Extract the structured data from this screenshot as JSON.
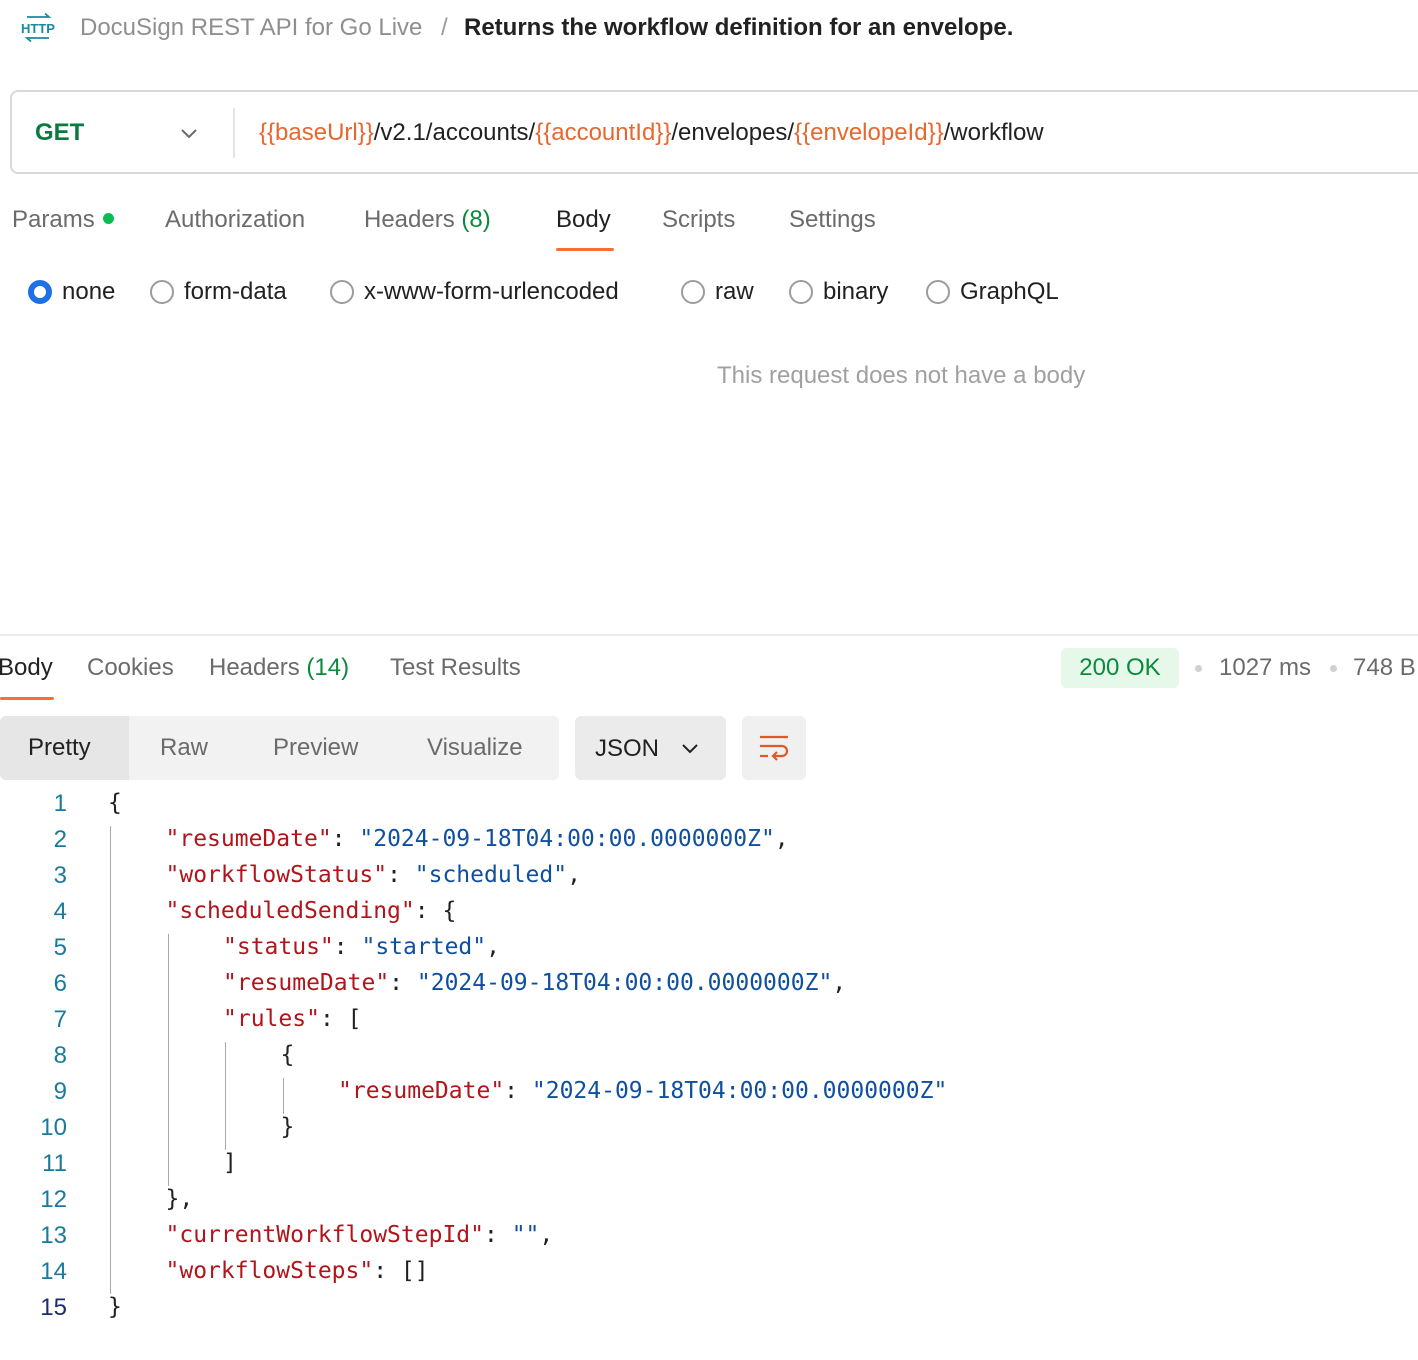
{
  "breadcrumb": {
    "icon": "http-request-icon",
    "collection": "DocuSign REST API for Go Live",
    "separator": "/",
    "title": "Returns the workflow definition for an envelope."
  },
  "request": {
    "method": "GET",
    "url_parts": [
      {
        "text": "{{baseUrl}}",
        "var": true
      },
      {
        "text": "/v2.1/accounts/",
        "var": false
      },
      {
        "text": "{{accountId}}",
        "var": true
      },
      {
        "text": "/envelopes/",
        "var": false
      },
      {
        "text": "{{envelopeId}}",
        "var": true
      },
      {
        "text": "/workflow",
        "var": false
      }
    ]
  },
  "request_tabs": {
    "params": "Params",
    "authorization": "Authorization",
    "headers": "Headers",
    "headers_count": "(8)",
    "body": "Body",
    "scripts": "Scripts",
    "settings": "Settings",
    "active": "Body"
  },
  "body_types": {
    "none": "none",
    "form_data": "form-data",
    "urlencoded": "x-www-form-urlencoded",
    "raw": "raw",
    "binary": "binary",
    "graphql": "GraphQL",
    "selected": "none"
  },
  "empty_body_message": "This request does not have a body",
  "response_tabs": {
    "body": "Body",
    "cookies": "Cookies",
    "headers": "Headers",
    "headers_count": "(14)",
    "test_results": "Test Results",
    "active": "Body"
  },
  "response_meta": {
    "status": "200 OK",
    "time": "1027 ms",
    "size": "748 B"
  },
  "view_modes": {
    "pretty": "Pretty",
    "raw": "Raw",
    "preview": "Preview",
    "visualize": "Visualize",
    "active": "Pretty"
  },
  "format": "JSON",
  "colors": {
    "accent": "#ff6c37",
    "variable": "#e8672e",
    "method_get": "#0b7a3e",
    "status_ok_bg": "#e5f8ea",
    "json_key": "#b0151b",
    "json_string": "#0f4f9e",
    "radio_selected": "#1f6fe6"
  },
  "response_lines": [
    {
      "n": "1",
      "indent": 0,
      "parts": [
        {
          "t": "{",
          "c": "p"
        }
      ]
    },
    {
      "n": "2",
      "indent": 1,
      "parts": [
        {
          "t": "\"resumeDate\"",
          "c": "k"
        },
        {
          "t": ": ",
          "c": "p"
        },
        {
          "t": "\"2024-09-18T04:00:00.0000000Z\"",
          "c": "s"
        },
        {
          "t": ",",
          "c": "p"
        }
      ]
    },
    {
      "n": "3",
      "indent": 1,
      "parts": [
        {
          "t": "\"workflowStatus\"",
          "c": "k"
        },
        {
          "t": ": ",
          "c": "p"
        },
        {
          "t": "\"scheduled\"",
          "c": "s"
        },
        {
          "t": ",",
          "c": "p"
        }
      ]
    },
    {
      "n": "4",
      "indent": 1,
      "parts": [
        {
          "t": "\"scheduledSending\"",
          "c": "k"
        },
        {
          "t": ": {",
          "c": "p"
        }
      ]
    },
    {
      "n": "5",
      "indent": 2,
      "parts": [
        {
          "t": "\"status\"",
          "c": "k"
        },
        {
          "t": ": ",
          "c": "p"
        },
        {
          "t": "\"started\"",
          "c": "s"
        },
        {
          "t": ",",
          "c": "p"
        }
      ]
    },
    {
      "n": "6",
      "indent": 2,
      "parts": [
        {
          "t": "\"resumeDate\"",
          "c": "k"
        },
        {
          "t": ": ",
          "c": "p"
        },
        {
          "t": "\"2024-09-18T04:00:00.0000000Z\"",
          "c": "s"
        },
        {
          "t": ",",
          "c": "p"
        }
      ]
    },
    {
      "n": "7",
      "indent": 2,
      "parts": [
        {
          "t": "\"rules\"",
          "c": "k"
        },
        {
          "t": ": [",
          "c": "p"
        }
      ]
    },
    {
      "n": "8",
      "indent": 3,
      "parts": [
        {
          "t": "{",
          "c": "p"
        }
      ]
    },
    {
      "n": "9",
      "indent": 4,
      "parts": [
        {
          "t": "\"resumeDate\"",
          "c": "k"
        },
        {
          "t": ": ",
          "c": "p"
        },
        {
          "t": "\"2024-09-18T04:00:00.0000000Z\"",
          "c": "s"
        }
      ]
    },
    {
      "n": "10",
      "indent": 3,
      "parts": [
        {
          "t": "}",
          "c": "p"
        }
      ]
    },
    {
      "n": "11",
      "indent": 2,
      "parts": [
        {
          "t": "]",
          "c": "p"
        }
      ]
    },
    {
      "n": "12",
      "indent": 1,
      "parts": [
        {
          "t": "},",
          "c": "p"
        }
      ]
    },
    {
      "n": "13",
      "indent": 1,
      "parts": [
        {
          "t": "\"currentWorkflowStepId\"",
          "c": "k"
        },
        {
          "t": ": ",
          "c": "p"
        },
        {
          "t": "\"\"",
          "c": "s"
        },
        {
          "t": ",",
          "c": "p"
        }
      ]
    },
    {
      "n": "14",
      "indent": 1,
      "parts": [
        {
          "t": "\"workflowSteps\"",
          "c": "k"
        },
        {
          "t": ": []",
          "c": "p"
        }
      ]
    },
    {
      "n": "15",
      "indent": 0,
      "parts": [
        {
          "t": "}",
          "c": "p"
        }
      ]
    }
  ]
}
